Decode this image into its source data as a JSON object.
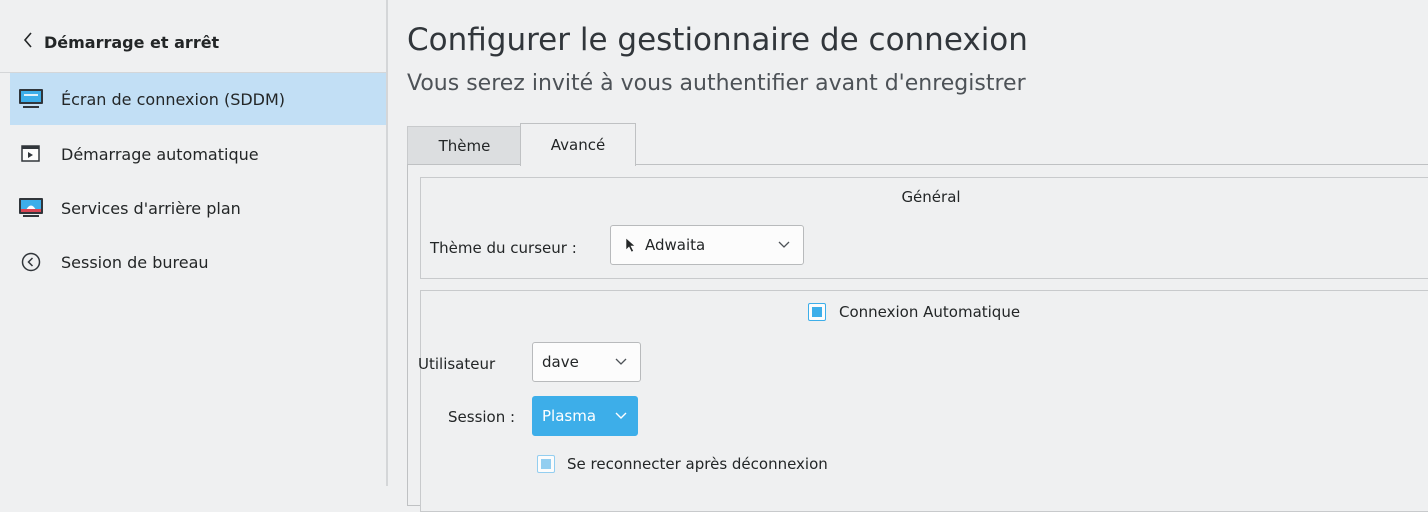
{
  "sidebar": {
    "back_label": "Démarrage et arrêt",
    "items": [
      {
        "label": "Écran de connexion (SDDM)",
        "icon": "monitor-icon",
        "selected": true
      },
      {
        "label": "Démarrage automatique",
        "icon": "autostart-icon"
      },
      {
        "label": "Services d'arrière plan",
        "icon": "background-services-icon"
      },
      {
        "label": "Session de bureau",
        "icon": "desktop-session-icon"
      }
    ]
  },
  "main": {
    "title": "Configurer le gestionnaire de connexion",
    "subtitle": "Vous serez invité à vous authentifier avant d'enregistrer",
    "tabs": [
      {
        "label": "Thème"
      },
      {
        "label": "Avancé",
        "active": true
      }
    ],
    "general": {
      "title": "Général",
      "cursor_label": "Thème du curseur :",
      "cursor_value": "Adwaita"
    },
    "autologin": {
      "checkbox_label": "Connexion Automatique",
      "checked": true,
      "user_label": "Utilisateur",
      "user_value": "dave",
      "session_label": "Session :",
      "session_value": "Plasma",
      "relogin_label": "Se reconnecter après déconnexion",
      "relogin_checked": true
    }
  },
  "colors": {
    "accent": "#3daee9",
    "selection": "#c2dff5",
    "background": "#eff0f1"
  }
}
